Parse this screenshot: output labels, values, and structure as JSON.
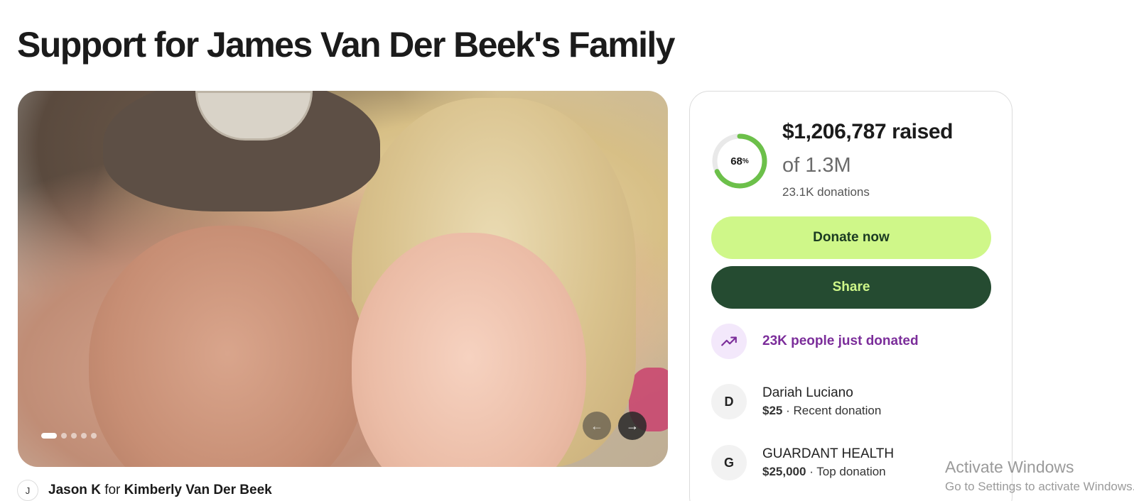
{
  "page": {
    "title": "Support for James Van Der Beek's Family"
  },
  "gallery": {
    "dots_total": 5,
    "dots_active": 1,
    "prev_icon": "arrow-left-icon",
    "next_icon": "arrow-right-icon",
    "prev_glyph": "←",
    "next_glyph": "→"
  },
  "organizer": {
    "avatar_initial": "J",
    "name": "Jason K",
    "connector": "for",
    "beneficiary": "Kimberly Van Der Beek"
  },
  "progress": {
    "percent": 68,
    "percent_label": "68",
    "percent_sign": "%",
    "raised": "$1,206,787 raised",
    "goal": "of 1.3M",
    "donations": "23.1K donations",
    "accent_color": "#6cc04a"
  },
  "buttons": {
    "donate": "Donate now",
    "share": "Share"
  },
  "activity": {
    "trend_text": "23K people just donated",
    "trend_icon": "trending-up-icon",
    "items": [
      {
        "initial": "D",
        "name": "Dariah Luciano",
        "amount": "$25",
        "note": "· Recent donation"
      },
      {
        "initial": "G",
        "name": "GUARDANT HEALTH",
        "amount": "$25,000",
        "note": "· Top donation"
      }
    ]
  },
  "watermark": {
    "line1": "Activate Windows",
    "line2": "Go to Settings to activate Windows."
  }
}
